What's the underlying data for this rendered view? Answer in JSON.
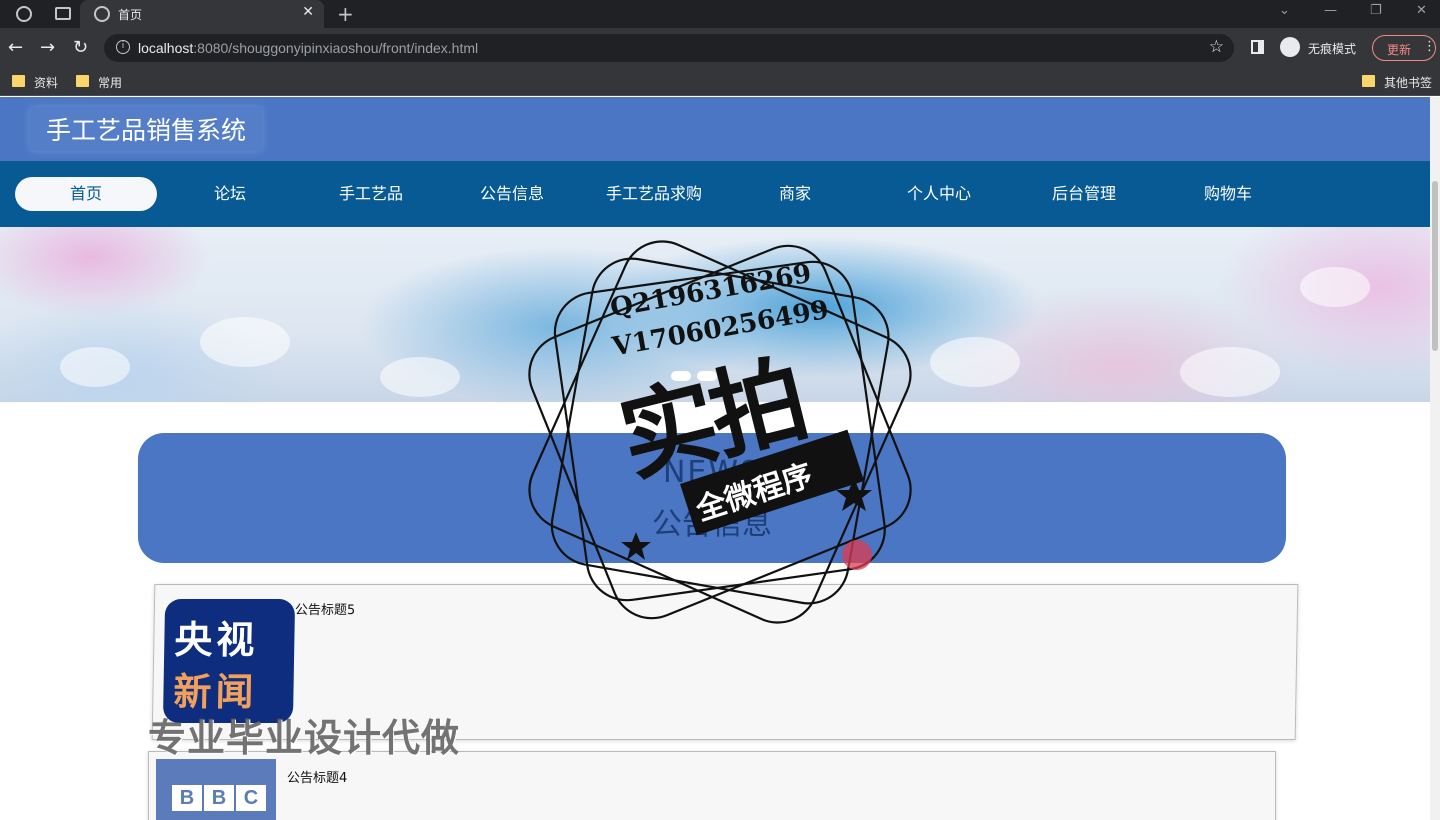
{
  "browser": {
    "tab_title": "首页",
    "url_host": "localhost",
    "url_rest": ":8080/shouggonyipinxiaoshou/front/index.html",
    "incognito_label": "无痕模式",
    "update_label": "更新",
    "bookmarks": [
      "资料",
      "常用"
    ],
    "other_bookmarks": "其他书签"
  },
  "site": {
    "title": "手工艺品销售系统"
  },
  "nav": {
    "items": [
      {
        "label": "首页",
        "active": true
      },
      {
        "label": "论坛"
      },
      {
        "label": "手工艺品"
      },
      {
        "label": "公告信息"
      },
      {
        "label": "手工艺品求购"
      },
      {
        "label": "商家"
      },
      {
        "label": "个人中心"
      },
      {
        "label": "后台管理"
      },
      {
        "label": "购物车"
      }
    ]
  },
  "news": {
    "heading_en": "NEWS",
    "heading_cn": "公告信息"
  },
  "cards": [
    {
      "title": "公告标题5",
      "thumb": "央视新闻"
    },
    {
      "title": "公告标题4",
      "thumb": "BBC"
    }
  ],
  "cctv": {
    "line1": "央视",
    "line2": "新闻"
  },
  "bbc": [
    "B",
    "B",
    "C"
  ],
  "overlay": {
    "qq": "Q2196316269",
    "wx": "V17060256499",
    "big": "实拍",
    "ribbon": "全微程序",
    "bottom_watermark": "专业毕业设计代做"
  }
}
